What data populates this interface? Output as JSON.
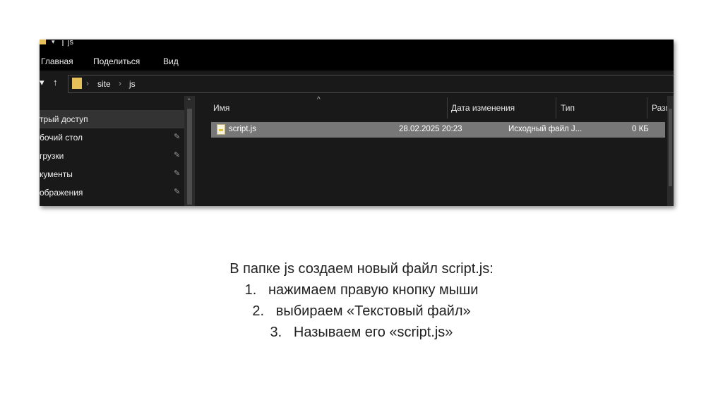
{
  "window": {
    "title": "js",
    "ribbon": [
      "Главная",
      "Поделиться",
      "Вид"
    ],
    "path": [
      "site",
      "js"
    ],
    "nav_items": [
      {
        "label": "трый доступ",
        "pinned": false,
        "selected": true
      },
      {
        "label": "бочий стол",
        "pinned": true,
        "selected": false
      },
      {
        "label": "грузки",
        "pinned": true,
        "selected": false
      },
      {
        "label": "кументы",
        "pinned": true,
        "selected": false
      },
      {
        "label": "ображения",
        "pinned": true,
        "selected": false
      }
    ],
    "columns": [
      "Имя",
      "Дата изменения",
      "Тип",
      "Размер"
    ],
    "files": [
      {
        "name": "script.js",
        "modified": "28.02.2025 20:23",
        "type": "Исходный файл J...",
        "size": "0 КБ"
      }
    ]
  },
  "caption": {
    "intro": "В папке js создаем новый файл script.js:",
    "steps": [
      {
        "num": "1.",
        "text": "нажимаем правую кнопку мыши"
      },
      {
        "num": "2.",
        "text": "выбираем «Текстовый файл»"
      },
      {
        "num": "3.",
        "text": "Называем его «script.js»"
      }
    ]
  },
  "icons": {
    "pin": "pin-icon",
    "folder": "folder-icon",
    "file": "js-file-icon",
    "back": "back-arrow-icon",
    "up": "up-arrow-icon",
    "breadcrumb_separator": "chevron-right-icon"
  }
}
